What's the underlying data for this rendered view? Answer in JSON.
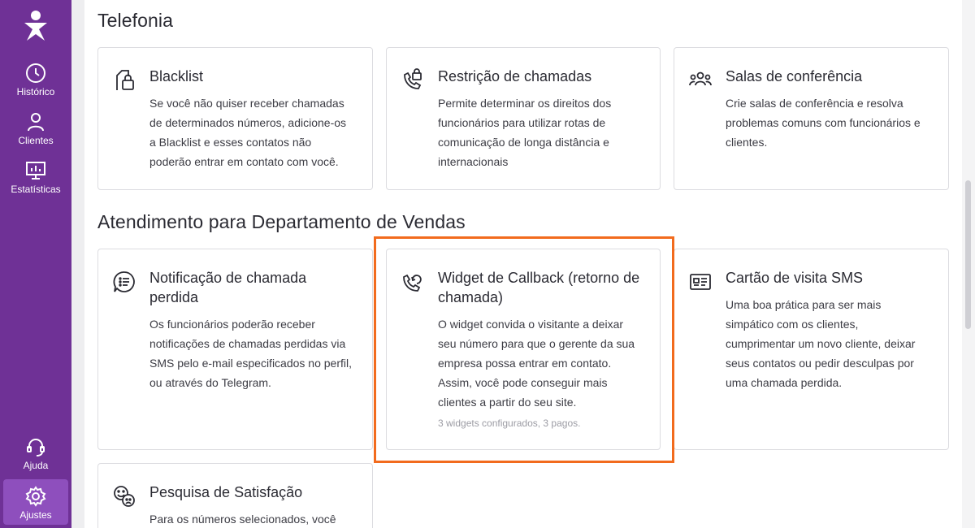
{
  "sidebar": {
    "items": [
      {
        "label": "Histórico",
        "icon": "clock-icon"
      },
      {
        "label": "Clientes",
        "icon": "user-icon"
      },
      {
        "label": "Estatísticas",
        "icon": "chart-icon"
      }
    ],
    "bottom_items": [
      {
        "label": "Ajuda",
        "icon": "headset-icon"
      },
      {
        "label": "Ajustes",
        "icon": "gear-icon",
        "active": true
      }
    ]
  },
  "sections": {
    "telefonia": {
      "title": "Telefonia",
      "cards": [
        {
          "title": "Blacklist",
          "icon": "lock-file-icon",
          "description": "Se você não quiser receber chamadas de determinados números, adicione-os a Blacklist e esses contatos não poderão entrar em contato com você."
        },
        {
          "title": "Restrição de chamadas",
          "icon": "phone-lock-icon",
          "description": "Permite determinar os direitos dos funcionários para utilizar rotas de comunicação de longa distância e internacionais"
        },
        {
          "title": "Salas de conferência",
          "icon": "group-icon",
          "description": "Crie salas de conferência e resolva problemas comuns com funcionários e clientes."
        }
      ]
    },
    "vendas": {
      "title": "Atendimento para Departamento de Vendas",
      "cards": [
        {
          "title": "Notificação de chamada perdida",
          "icon": "chat-list-icon",
          "description": "Os funcionários poderão receber notificações de chamadas perdidas via SMS pelo e-mail especificados no perfil, ou através do Telegram."
        },
        {
          "title": "Widget de Callback (retorno de chamada)",
          "icon": "phone-callback-icon",
          "description": "O widget convida o visitante a deixar seu número para que o gerente da sua empresa possa entrar em contato. Assim, você pode conseguir mais clientes a partir do seu site.",
          "meta": "3 widgets configurados, 3 pagos."
        },
        {
          "title": "Cartão de visita SMS",
          "icon": "id-card-icon",
          "description": "Uma boa prática para ser mais simpático com os clientes, cumprimentar um novo cliente, deixar seus contatos ou pedir desculpas por uma chamada perdida."
        },
        {
          "title": "Pesquisa de Satisfação",
          "icon": "smiley-faces-icon",
          "description": "Para os números selecionados, você"
        }
      ]
    }
  },
  "colors": {
    "sidebar": "#6f3196",
    "sidebar_active": "#8e4fbd",
    "highlight": "#f26b1d"
  }
}
